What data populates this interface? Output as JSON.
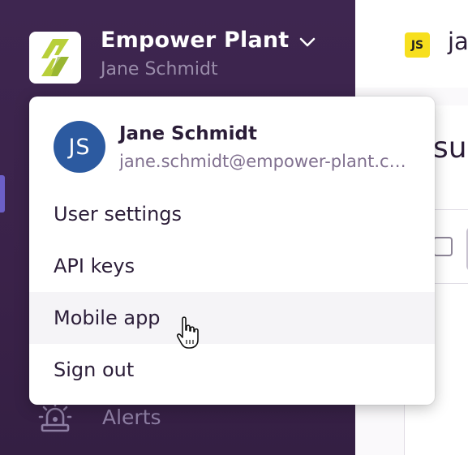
{
  "sidebar": {
    "org": {
      "name": "Empower Plant",
      "user": "Jane Schmidt",
      "logo_icon": "lightning-bolt-logo",
      "chevron_icon": "chevron-down-icon"
    },
    "nav": {
      "alerts_label": "Alerts",
      "alerts_icon": "siren-icon"
    }
  },
  "topbar": {
    "project_badge": "JS",
    "project_name": "ja"
  },
  "main": {
    "heading_partial": "su"
  },
  "user_menu": {
    "avatar_initials": "JS",
    "name": "Jane Schmidt",
    "email": "jane.schmidt@empower-plant.com",
    "items": [
      {
        "label": "User settings"
      },
      {
        "label": "API keys"
      },
      {
        "label": "Mobile app"
      },
      {
        "label": "Sign out"
      }
    ],
    "hovered_item": "Mobile app"
  },
  "colors": {
    "sidebar_bg": "#3e2650",
    "accent": "#6c5fc7",
    "avatar_bg": "#2c5aa0",
    "js_badge": "#f7df1e",
    "logo_green": "#a6c436"
  }
}
